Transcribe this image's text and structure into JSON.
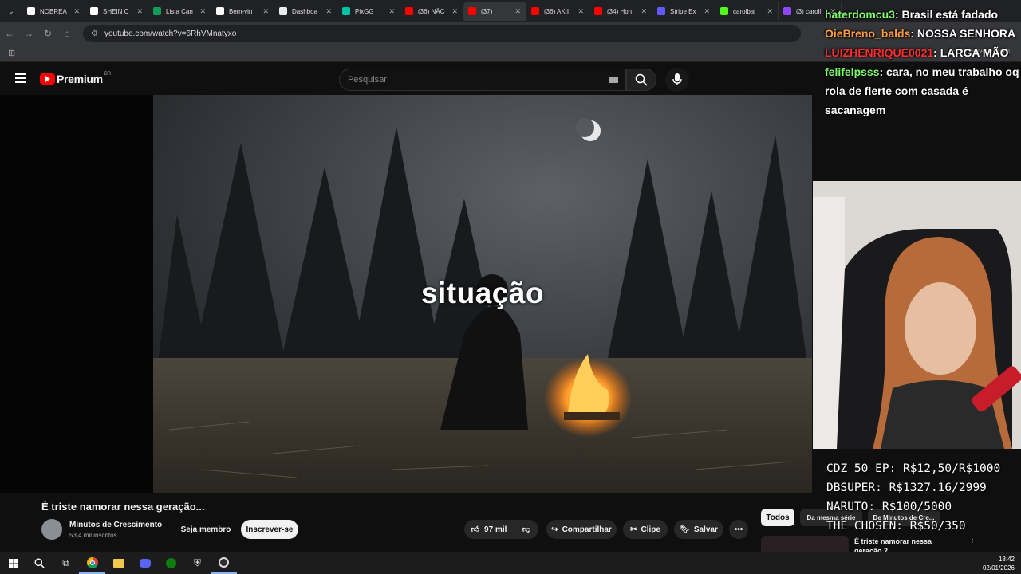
{
  "browser": {
    "tabs": [
      {
        "label": "NOBREA",
        "color": "#ffffff"
      },
      {
        "label": "SHEIN C",
        "color": "#ffffff"
      },
      {
        "label": "Lista Can",
        "color": "#0f9d58"
      },
      {
        "label": "Bem-vin",
        "color": "#ffffff"
      },
      {
        "label": "Dashboa",
        "color": "#e8eaed"
      },
      {
        "label": "PixGG",
        "color": "#00c2a8"
      },
      {
        "label": "(36) NÃC",
        "color": "#ff0000"
      },
      {
        "label": "(37) I",
        "color": "#ff0000",
        "active": true
      },
      {
        "label": "(36) AKII",
        "color": "#ff0000"
      },
      {
        "label": "(34) Hon",
        "color": "#ff0000"
      },
      {
        "label": "Stripe Ex",
        "color": "#635bff"
      },
      {
        "label": "carolbal",
        "color": "#53fc18"
      },
      {
        "label": "(3) caroll",
        "color": "#9146ff"
      }
    ],
    "url": "youtube.com/watch?v=6RhVMnatyxo",
    "bookmarks_label": "Todos os favoritos"
  },
  "youtube": {
    "logo_text": "Premium",
    "logo_region": "BR",
    "search_placeholder": "Pesquisar",
    "video_caption": "situação",
    "video_title": "É triste namorar nessa geração...",
    "channel_name": "Minutos de Crescimento",
    "subscribers": "53,4 mil inscritos",
    "member_button": "Seja membro",
    "subscribe_button": "Inscrever-se",
    "like_count": "97 mil",
    "share_button": "Compartilhar",
    "clip_button": "Clipe",
    "save_button": "Salvar",
    "filter_chips": [
      "Todos",
      "Da mesma série",
      "De Minutos de Cre..."
    ],
    "next_video_title": "É triste namorar nessa geração 2"
  },
  "stream_overlay": {
    "chat": [
      {
        "user": "haterdomcu3",
        "user_color": "#7cfc6a",
        "message": ": Brasil está fadado"
      },
      {
        "user": "OieBreno_balds",
        "user_color": "#ff9b3d",
        "message": ": NOSSA SENHORA"
      },
      {
        "user": "LUIZHENRIQUE0021",
        "user_color": "#ff2d2d",
        "message": ": LARGA MÃO"
      },
      {
        "user": "felifelpsss",
        "user_color": "#7cfc6a",
        "message": ": cara, no meu trabalho oq rola de flerte com casada é sacanagem"
      }
    ],
    "goals": [
      "CDZ 50 EP: R$12,50/R$1000",
      "DBSUPER: R$1327.16/2999",
      "NARUTO: R$100/5000",
      "THE CHOSEN: R$50/350"
    ]
  },
  "taskbar": {
    "time": "18:42",
    "date": "02/01/2026"
  }
}
